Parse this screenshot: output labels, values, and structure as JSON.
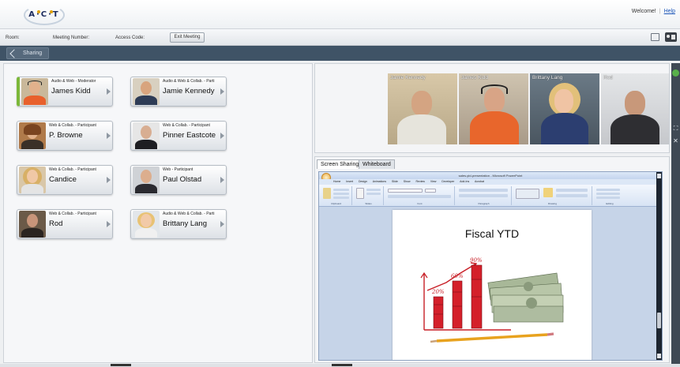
{
  "header": {
    "logo_text": "A·C·T",
    "welcome": "Welcome!",
    "help": "Help"
  },
  "meeting": {
    "room_label": "Room:",
    "meeting_number_label": "Meeting Number:",
    "access_code_label": "Access Code:",
    "exit_label": "Exit Meeting"
  },
  "sharebar": {
    "tab_label": "Sharing"
  },
  "participants": [
    {
      "role": "Audio & Web - Moderator",
      "name": "James Kidd"
    },
    {
      "role": "Audio & Web & Collab. - Parti",
      "name": "Jamie Kennedy"
    },
    {
      "role": "Web & Collab. - Participant",
      "name": "P. Browne"
    },
    {
      "role": "Web & Collab. - Participant",
      "name": "Pinner Eastcote"
    },
    {
      "role": "Web & Collab. - Participant",
      "name": "Candice"
    },
    {
      "role": "Web - Participant",
      "name": "Paul Olstad"
    },
    {
      "role": "Web & Collab. - Participant",
      "name": "Rod"
    },
    {
      "role": "Audio & Web & Collab. - Parti",
      "name": "Brittany Lang"
    }
  ],
  "videos": [
    {
      "name": "Jamie Kennedy"
    },
    {
      "name": "James Kidd"
    },
    {
      "name": "Brittany Lang"
    },
    {
      "name": "Rod"
    }
  ],
  "tabs": {
    "screen_sharing": "Screen Sharing",
    "whiteboard": "Whiteboard"
  },
  "ppt": {
    "window_title": "sales-ytd-presentation - Microsoft PowerPoint",
    "menu": "Home Insert Design Animations Slide Show Review View Developer Add-Ins Acrobat",
    "groups": [
      "Clipboard",
      "Slides",
      "Font",
      "Paragraph",
      "Drawing",
      "Editing"
    ],
    "slide_title": "Fiscal YTD",
    "bar_labels": [
      "20%",
      "60%",
      "90%"
    ]
  },
  "colors": {
    "sharebar": "#3f5366",
    "moderator_indicator": "#7cb83a",
    "bar_red": "#d4202a",
    "sidebar_dark": "#3f4954"
  }
}
